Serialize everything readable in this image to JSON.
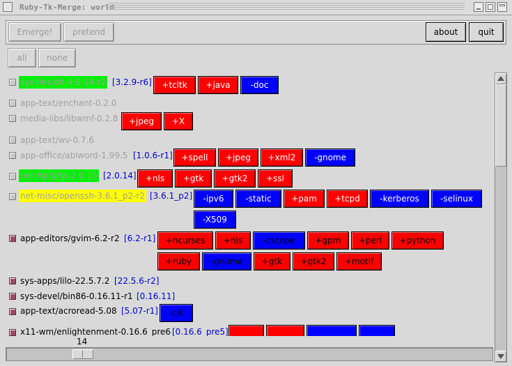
{
  "window": {
    "title": "Ruby-Tk-Merge: world"
  },
  "toolbar": {
    "emerge_label": "Emerge!",
    "pretend_label": "pretend",
    "about_label": "about",
    "quit_label": "quit"
  },
  "selection": {
    "all_label": "all",
    "none_label": "none"
  },
  "colors": {
    "enabled_flag": "#ff0000",
    "disabled_flag": "#0000ff",
    "pkg_green": "#00f000",
    "pkg_yellow": "#ffff00",
    "version": "#0000cc"
  },
  "packages": [
    {
      "name": "sys-libs/db-4.0.14-r2",
      "version": "[3.2.9-r6]",
      "checked": false
    },
    {
      "name": "app-text/enchant-0.2.0",
      "checked": false
    },
    {
      "name": "media-libs/libwmf-0.2.8",
      "checked": false
    },
    {
      "name": "app-text/wv-0.7.6",
      "checked": false
    },
    {
      "name": "app-office/abiword-1.99.5",
      "version": "[1.0.6-r1]",
      "checked": false
    },
    {
      "name": "net-ftp/gftp-2.0.15",
      "version": "[2.0.14]",
      "checked": false
    },
    {
      "name": "net-misc/openssh-3.6.1_p2-r2",
      "version": "[3.6.1_p2]",
      "checked": false
    },
    {
      "name": "app-editors/gvim-6.2-r2",
      "version": "[6.2-r1]",
      "checked": true
    },
    {
      "name": "sys-apps/lilo-22.5.7.2",
      "version": "[22.5.6-r2]",
      "checked": true
    },
    {
      "name": "sys-devel/bin86-0.16.11-r1",
      "version": "[0.16.11]",
      "checked": true
    },
    {
      "name": "app-text/acroread-5.08",
      "version": "[5.07-r1]",
      "checked": true
    },
    {
      "name": "x11-wm/enlightenment-0.16.6_pre6",
      "version": "[0.16.6_pre5]",
      "checked": true
    }
  ],
  "flags": {
    "db": [
      "+tcltk",
      "+java",
      "-doc"
    ],
    "libwmf": [
      "+jpeg",
      "+X"
    ],
    "abiword": [
      "+spell",
      "+jpeg",
      "+xml2",
      "-gnome"
    ],
    "gftp": [
      "+nls",
      "+gtk",
      "+gtk2",
      "+ssl"
    ],
    "openssh": [
      "-ipv6",
      "-static",
      "+pam",
      "+tcpd",
      "-kerberos",
      "-selinux",
      "-X509"
    ],
    "gvim": [
      "+ncurses",
      "+nls",
      "-cscope",
      "+gpm",
      "+perl",
      "+python",
      "+ruby",
      "-gnome",
      "+gtk",
      "+gtk2",
      "+motif"
    ],
    "acroread": [
      "-cjk"
    ]
  },
  "scale": {
    "value": "14"
  }
}
